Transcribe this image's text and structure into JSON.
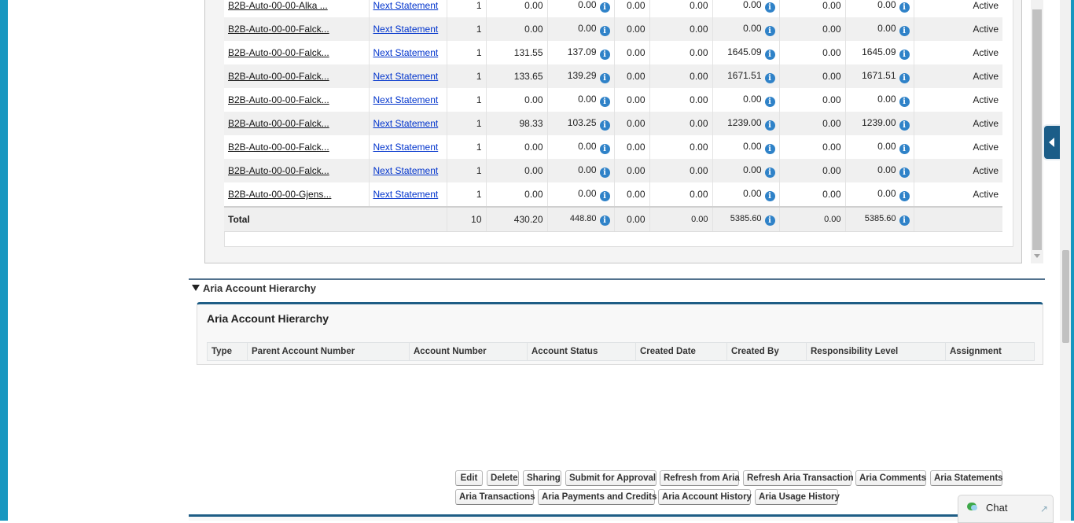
{
  "statements": {
    "rows": [
      {
        "account": "B2B-Auto-00-00-Alka ...",
        "link": "Next Statement",
        "count": "1",
        "amount1": "0.00",
        "amount2": "0.00",
        "amount3": "0.00",
        "amount4": "0.00",
        "amount5": "0.00",
        "amount6": "0.00",
        "amount7": "0.00",
        "status": "Active"
      },
      {
        "account": "B2B-Auto-00-00-Falck...",
        "link": "Next Statement",
        "count": "1",
        "amount1": "0.00",
        "amount2": "0.00",
        "amount3": "0.00",
        "amount4": "0.00",
        "amount5": "0.00",
        "amount6": "0.00",
        "amount7": "0.00",
        "status": "Active"
      },
      {
        "account": "B2B-Auto-00-00-Falck...",
        "link": "Next Statement",
        "count": "1",
        "amount1": "131.55",
        "amount2": "137.09",
        "amount3": "0.00",
        "amount4": "0.00",
        "amount5": "1645.09",
        "amount6": "0.00",
        "amount7": "1645.09",
        "status": "Active"
      },
      {
        "account": "B2B-Auto-00-00-Falck...",
        "link": "Next Statement",
        "count": "1",
        "amount1": "133.65",
        "amount2": "139.29",
        "amount3": "0.00",
        "amount4": "0.00",
        "amount5": "1671.51",
        "amount6": "0.00",
        "amount7": "1671.51",
        "status": "Active"
      },
      {
        "account": "B2B-Auto-00-00-Falck...",
        "link": "Next Statement",
        "count": "1",
        "amount1": "0.00",
        "amount2": "0.00",
        "amount3": "0.00",
        "amount4": "0.00",
        "amount5": "0.00",
        "amount6": "0.00",
        "amount7": "0.00",
        "status": "Active"
      },
      {
        "account": "B2B-Auto-00-00-Falck...",
        "link": "Next Statement",
        "count": "1",
        "amount1": "98.33",
        "amount2": "103.25",
        "amount3": "0.00",
        "amount4": "0.00",
        "amount5": "1239.00",
        "amount6": "0.00",
        "amount7": "1239.00",
        "status": "Active"
      },
      {
        "account": "B2B-Auto-00-00-Falck...",
        "link": "Next Statement",
        "count": "1",
        "amount1": "0.00",
        "amount2": "0.00",
        "amount3": "0.00",
        "amount4": "0.00",
        "amount5": "0.00",
        "amount6": "0.00",
        "amount7": "0.00",
        "status": "Active"
      },
      {
        "account": "B2B-Auto-00-00-Falck...",
        "link": "Next Statement",
        "count": "1",
        "amount1": "0.00",
        "amount2": "0.00",
        "amount3": "0.00",
        "amount4": "0.00",
        "amount5": "0.00",
        "amount6": "0.00",
        "amount7": "0.00",
        "status": "Active"
      },
      {
        "account": "B2B-Auto-00-00-Gjens...",
        "link": "Next Statement",
        "count": "1",
        "amount1": "0.00",
        "amount2": "0.00",
        "amount3": "0.00",
        "amount4": "0.00",
        "amount5": "0.00",
        "amount6": "0.00",
        "amount7": "0.00",
        "status": "Active"
      }
    ],
    "total": {
      "label": "Total",
      "count": "10",
      "amount1": "430.20",
      "amount2": "448.80",
      "amount3": "0.00",
      "amount4": "0.00",
      "amount5": "5385.60",
      "amount6": "0.00",
      "amount7": "5385.60"
    }
  },
  "hierarchy": {
    "section_label": "Aria Account Hierarchy",
    "panel_title": "Aria Account Hierarchy",
    "columns": [
      "Type",
      "Parent Account Number",
      "Account Number",
      "Account Status",
      "Created Date",
      "Created By",
      "Responsibility Level",
      "Assignment"
    ]
  },
  "buttons": {
    "row1": [
      "Edit",
      "Delete",
      "Sharing",
      "Submit for Approval",
      "Refresh from Aria",
      "Refresh Aria Transaction",
      "Aria Comments",
      "Aria Statements"
    ],
    "row2": [
      "Aria Transactions",
      "Aria Payments and Credits",
      "Aria Account History",
      "Aria Usage History"
    ]
  },
  "chat": {
    "label": "Chat"
  },
  "icons": {
    "info": "info-icon",
    "section_toggle": "caret-down-icon",
    "sidebar_toggle": "collapse-left-icon",
    "chat": "chat-bubble-icon",
    "chat_expand": "expand-icon"
  },
  "colors": {
    "accent": "#1797c0",
    "section_rule": "#1e5d85",
    "link": "#0033cc",
    "info_icon": "#2f82c8"
  }
}
